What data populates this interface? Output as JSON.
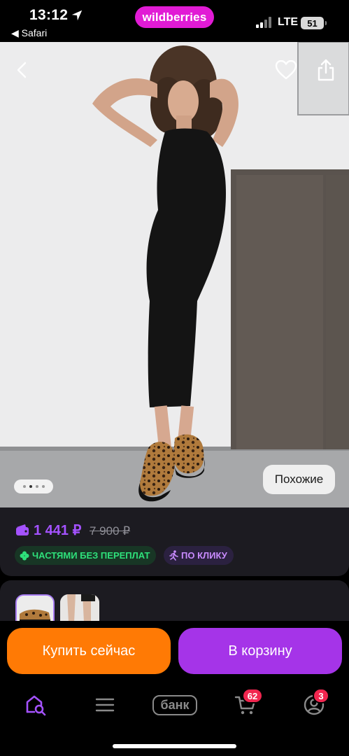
{
  "status_bar": {
    "time": "13:12",
    "back_app": "◀ Safari",
    "brand": "wildberries",
    "network": "LTE",
    "battery": "51",
    "brand_color": "#e11bd5"
  },
  "product_photo": {
    "carousel_count": 4,
    "carousel_active": 2,
    "similar_label": "Похожие"
  },
  "price": {
    "current": "1 441 ₽",
    "old": "7 900 ₽",
    "accent_color": "#a452ff"
  },
  "badges": {
    "installments": "ЧАСТЯМИ БЕЗ ПЕРЕПЛАТ",
    "one_click": "ПО КЛИКУ"
  },
  "actions": {
    "buy_now": "Купить сейчас",
    "add_to_cart": "В корзину",
    "buy_color": "#ff7a05",
    "cart_color": "#a534e8"
  },
  "tabbar": {
    "items": [
      {
        "name": "home",
        "icon": "home-search-icon",
        "active": true
      },
      {
        "name": "catalog",
        "icon": "menu-icon"
      },
      {
        "name": "bank",
        "label": "банк"
      },
      {
        "name": "cart",
        "icon": "cart-icon",
        "badge": "62"
      },
      {
        "name": "profile",
        "icon": "profile-icon",
        "badge": "3"
      }
    ]
  }
}
